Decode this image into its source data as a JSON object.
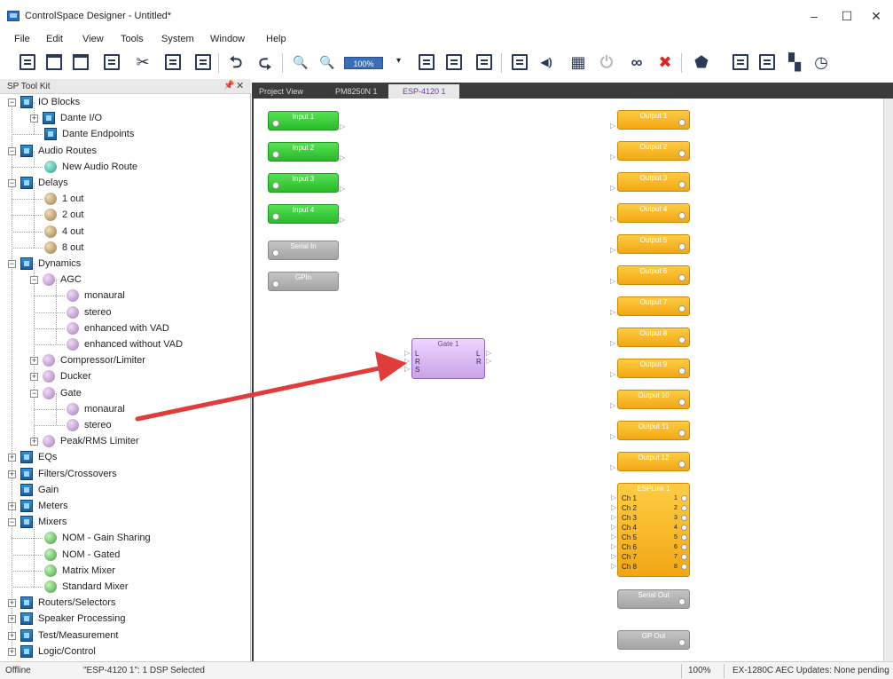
{
  "window": {
    "title": "ControlSpace Designer - Untitled*",
    "minimize_glyph": "–",
    "maximize_glyph": "☐",
    "close_glyph": "✕"
  },
  "menu": [
    "File",
    "Edit",
    "View",
    "Tools",
    "System",
    "Window",
    "Help"
  ],
  "toolbar": {
    "zoom": "100%",
    "zoom_dropdown_glyph": "▾",
    "icons": [
      "new-document-icon",
      "open-icon",
      "open-folder-icon",
      "save-icon",
      "cut-icon",
      "copy-icon",
      "paste-icon",
      "undo-icon",
      "redo-icon",
      "zoom-in-icon",
      "zoom-out-icon",
      "grid-icon",
      "window-icon",
      "window-icon",
      "page-icon",
      "speaker-icon",
      "network-icon",
      "power-icon",
      "binoculars-icon",
      "connect-icon",
      "firmware-icon",
      "list-icon",
      "list-icon",
      "device-icon",
      "clock-icon"
    ],
    "glyphs": {
      "cut": "✂",
      "undo": "⮌",
      "redo": "⮎",
      "zoom_in": "🔍",
      "zoom_out": "🔍",
      "speaker": "◀)",
      "network": "▦",
      "power": "⏻",
      "binoculars": "∞",
      "connect": "✖",
      "firmware": "⬟",
      "device": "▚",
      "clock": "◷"
    }
  },
  "toolkit": {
    "title": "SP Tool Kit",
    "pin_glyph": "📌",
    "close_glyph": "✕",
    "items": [
      {
        "label": "IO Blocks",
        "exp": "−",
        "icon": "folder"
      },
      {
        "label": "Dante I/O",
        "exp": "+",
        "icon": "folder"
      },
      {
        "label": "Dante Endpoints",
        "exp": "",
        "icon": "folder"
      },
      {
        "label": "Audio Routes",
        "exp": "−",
        "icon": "folder"
      },
      {
        "label": "New Audio Route",
        "exp": "",
        "icon": "teal"
      },
      {
        "label": "Delays",
        "exp": "−",
        "icon": "folder"
      },
      {
        "label": "1 out",
        "exp": "",
        "icon": "tan"
      },
      {
        "label": "2 out",
        "exp": "",
        "icon": "tan"
      },
      {
        "label": "4 out",
        "exp": "",
        "icon": "tan"
      },
      {
        "label": "8 out",
        "exp": "",
        "icon": "tan"
      },
      {
        "label": "Dynamics",
        "exp": "−",
        "icon": "folder"
      },
      {
        "label": "AGC",
        "exp": "−",
        "icon": "lilac"
      },
      {
        "label": "monaural",
        "exp": "",
        "icon": "lilac"
      },
      {
        "label": "stereo",
        "exp": "",
        "icon": "lilac"
      },
      {
        "label": "enhanced with VAD",
        "exp": "",
        "icon": "lilac"
      },
      {
        "label": "enhanced without VAD",
        "exp": "",
        "icon": "lilac"
      },
      {
        "label": "Compressor/Limiter",
        "exp": "+",
        "icon": "lilac"
      },
      {
        "label": "Ducker",
        "exp": "+",
        "icon": "lilac"
      },
      {
        "label": "Gate",
        "exp": "−",
        "icon": "lilac"
      },
      {
        "label": "monaural",
        "exp": "",
        "icon": "lilac"
      },
      {
        "label": "stereo",
        "exp": "",
        "icon": "lilac"
      },
      {
        "label": "Peak/RMS Limiter",
        "exp": "+",
        "icon": "lilac"
      },
      {
        "label": "EQs",
        "exp": "+",
        "icon": "folder"
      },
      {
        "label": "Filters/Crossovers",
        "exp": "+",
        "icon": "folder"
      },
      {
        "label": "Gain",
        "exp": "",
        "icon": "folder"
      },
      {
        "label": "Meters",
        "exp": "+",
        "icon": "folder"
      },
      {
        "label": "Mixers",
        "exp": "−",
        "icon": "folder"
      },
      {
        "label": "NOM - Gain Sharing",
        "exp": "",
        "icon": "green"
      },
      {
        "label": "NOM - Gated",
        "exp": "",
        "icon": "green"
      },
      {
        "label": "Matrix Mixer",
        "exp": "",
        "icon": "green"
      },
      {
        "label": "Standard Mixer",
        "exp": "",
        "icon": "green"
      },
      {
        "label": "Routers/Selectors",
        "exp": "+",
        "icon": "folder"
      },
      {
        "label": "Speaker Processing",
        "exp": "+",
        "icon": "folder"
      },
      {
        "label": "Test/Measurement",
        "exp": "+",
        "icon": "folder"
      },
      {
        "label": "Logic/Control",
        "exp": "+",
        "icon": "folder"
      }
    ]
  },
  "tabs": [
    "Project View",
    "PM8250N 1",
    "ESP-4120 1"
  ],
  "canvas": {
    "inputs": [
      "Input 1",
      "Input 2",
      "Input 3",
      "Input 4"
    ],
    "grey_inputs": [
      "Serial In",
      "GPIn"
    ],
    "outputs": [
      "Output 1",
      "Output 2",
      "Output 3",
      "Output 4",
      "Output 5",
      "Output 6",
      "Output 7",
      "Output 8",
      "Output 9",
      "Output 10",
      "Output 11",
      "Output 12"
    ],
    "esplink": {
      "title": "ESPLink 1",
      "channels": [
        "Ch 1",
        "Ch 2",
        "Ch 3",
        "Ch 4",
        "Ch 5",
        "Ch 6",
        "Ch 7",
        "Ch 8"
      ],
      "numbers": [
        "1",
        "2",
        "3",
        "4",
        "5",
        "6",
        "7",
        "8"
      ]
    },
    "grey_outputs": [
      "Serial Out",
      "GP Out"
    ],
    "gate": {
      "title": "Gate 1",
      "in_pins": [
        "L",
        "R",
        "S"
      ],
      "out_pins": [
        "L",
        "R"
      ]
    }
  },
  "status": {
    "left": "Offline",
    "selected": "\"ESP-4120 1\": 1 DSP Selected",
    "zoom": "100%",
    "right": "EX-1280C AEC Updates: None pending"
  },
  "colors": {
    "arrow": "#e23b3b",
    "input_green": "#2fbf2f",
    "output_orange": "#f4ad1a",
    "gate_purple": "#d9b9f0"
  }
}
